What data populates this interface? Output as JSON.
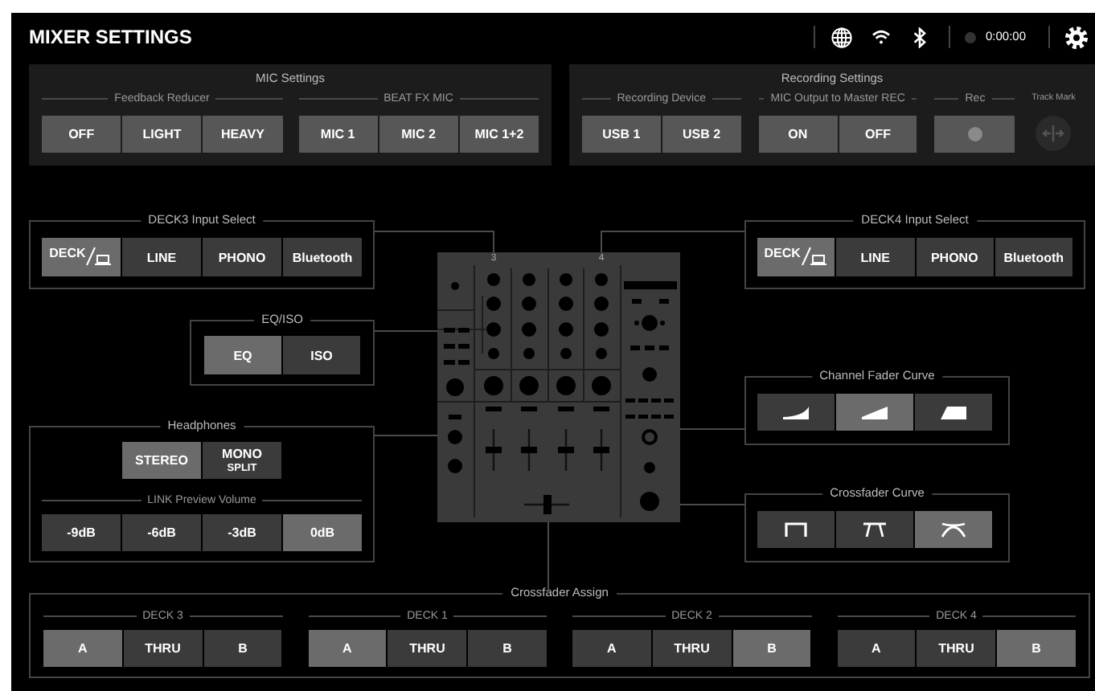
{
  "header": {
    "title": "MIXER SETTINGS",
    "recording_time": "0:00:00"
  },
  "mic_settings": {
    "title": "MIC Settings",
    "groups": [
      {
        "label": "Feedback Reducer",
        "options": [
          {
            "label": "OFF",
            "selected": false
          },
          {
            "label": "LIGHT",
            "selected": false
          },
          {
            "label": "HEAVY",
            "selected": false
          }
        ]
      },
      {
        "label": "BEAT FX MIC",
        "options": [
          {
            "label": "MIC 1",
            "selected": false
          },
          {
            "label": "MIC 2",
            "selected": false
          },
          {
            "label": "MIC 1+2",
            "selected": false
          }
        ]
      }
    ]
  },
  "recording_settings": {
    "title": "Recording Settings",
    "groups": [
      {
        "label": "Recording Device",
        "options": [
          {
            "label": "USB 1",
            "selected": false
          },
          {
            "label": "USB 2",
            "selected": false
          }
        ]
      },
      {
        "label": "MIC Output to Master REC",
        "options": [
          {
            "label": "ON",
            "selected": false
          },
          {
            "label": "OFF",
            "selected": false
          }
        ]
      }
    ],
    "rec": {
      "label": "Rec"
    },
    "track_mark": {
      "label": "Track Mark",
      "disabled": true
    }
  },
  "deck3_input": {
    "title": "DECK3 Input Select",
    "options": [
      {
        "label": "DECK",
        "kind": "deck",
        "selected": true
      },
      {
        "label": "LINE",
        "kind": "text",
        "selected": false
      },
      {
        "label": "PHONO",
        "kind": "text",
        "selected": false
      },
      {
        "label": "Bluetooth",
        "kind": "text",
        "selected": false
      }
    ]
  },
  "eq_iso": {
    "title": "EQ/ISO",
    "options": [
      {
        "label": "EQ",
        "selected": true
      },
      {
        "label": "ISO",
        "selected": false
      }
    ]
  },
  "headphones": {
    "title": "Headphones",
    "modes": [
      {
        "label": "STEREO",
        "selected": true
      },
      {
        "label": "MONO",
        "sublabel": "SPLIT",
        "selected": false
      }
    ],
    "link_preview_volume": {
      "title": "LINK Preview Volume",
      "options": [
        {
          "label": "-9dB",
          "selected": false
        },
        {
          "label": "-6dB",
          "selected": false
        },
        {
          "label": "-3dB",
          "selected": false
        },
        {
          "label": "0dB",
          "selected": true
        }
      ]
    }
  },
  "mixer": {
    "channel_numbers": [
      "3",
      "4"
    ]
  },
  "deck4_input": {
    "title": "DECK4 Input Select",
    "options": [
      {
        "label": "DECK",
        "kind": "deck",
        "selected": true
      },
      {
        "label": "LINE",
        "kind": "text",
        "selected": false
      },
      {
        "label": "PHONO",
        "kind": "text",
        "selected": false
      },
      {
        "label": "Bluetooth",
        "kind": "text",
        "selected": false
      }
    ]
  },
  "channel_fader_curve": {
    "title": "Channel Fader Curve",
    "options": [
      {
        "kind": "concave",
        "selected": false
      },
      {
        "kind": "linear",
        "selected": true
      },
      {
        "kind": "convex",
        "selected": false
      }
    ]
  },
  "crossfader_curve": {
    "title": "Crossfader Curve",
    "options": [
      {
        "kind": "sharp",
        "selected": false
      },
      {
        "kind": "medium",
        "selected": false
      },
      {
        "kind": "smooth",
        "selected": true
      }
    ]
  },
  "crossfader_assign": {
    "title": "Crossfader Assign",
    "decks": [
      {
        "label": "DECK 3",
        "options": [
          {
            "label": "A",
            "selected": true
          },
          {
            "label": "THRU",
            "selected": false
          },
          {
            "label": "B",
            "selected": false
          }
        ]
      },
      {
        "label": "DECK 1",
        "options": [
          {
            "label": "A",
            "selected": true
          },
          {
            "label": "THRU",
            "selected": false
          },
          {
            "label": "B",
            "selected": false
          }
        ]
      },
      {
        "label": "DECK 2",
        "options": [
          {
            "label": "A",
            "selected": false
          },
          {
            "label": "THRU",
            "selected": false
          },
          {
            "label": "B",
            "selected": true
          }
        ]
      },
      {
        "label": "DECK 4",
        "options": [
          {
            "label": "A",
            "selected": false
          },
          {
            "label": "THRU",
            "selected": false
          },
          {
            "label": "B",
            "selected": true
          }
        ]
      }
    ]
  }
}
